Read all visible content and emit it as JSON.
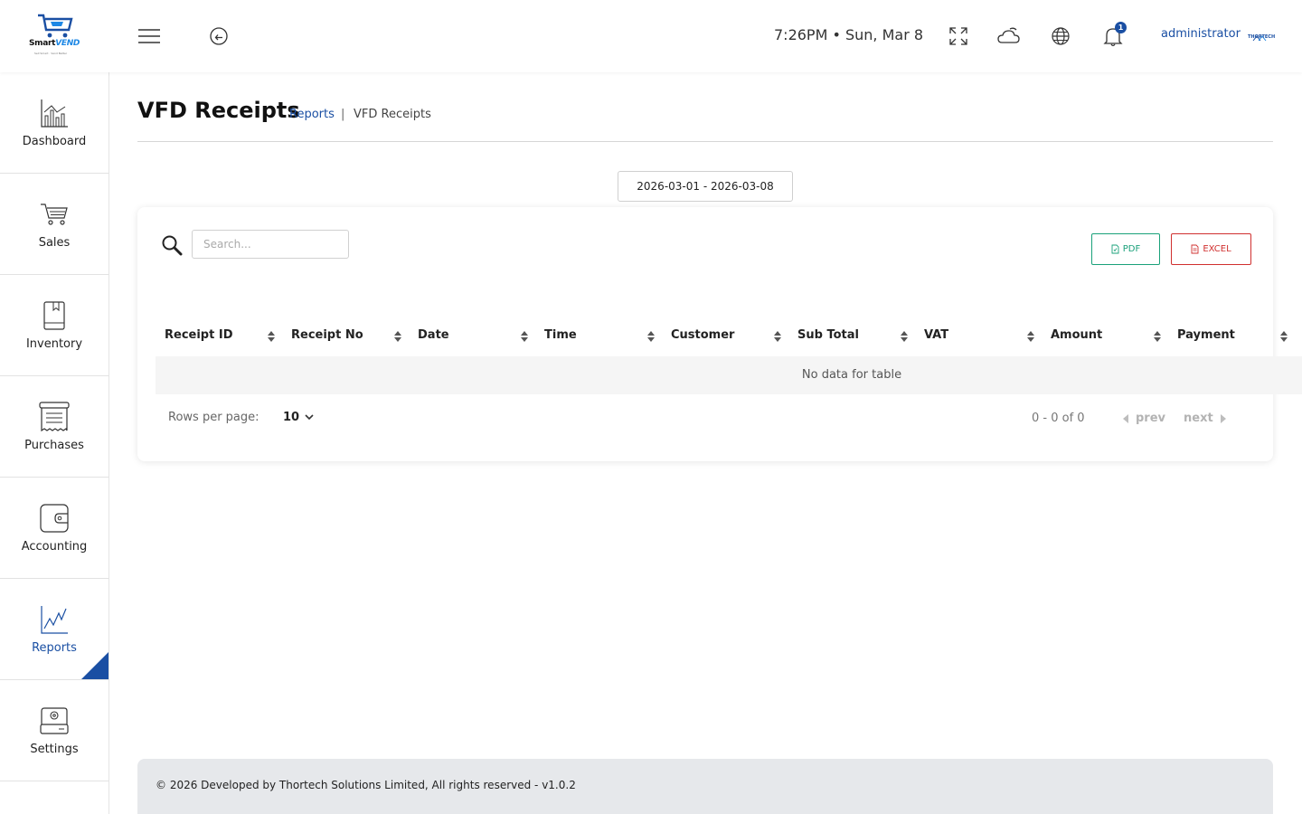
{
  "app": {
    "logo_text": "SmartVEND",
    "logo_part1": "Smart",
    "logo_part2": "VEND",
    "logo_tagline": "Sell Smart · Vend Better"
  },
  "header": {
    "clock": "7:26PM • Sun, Mar 8",
    "notification_count": "1",
    "username": "administrator",
    "company_logo_text": "THORTECH"
  },
  "sidebar": {
    "items": [
      {
        "label": "Dashboard",
        "icon": "chart-bar-icon",
        "active": false
      },
      {
        "label": "Sales",
        "icon": "shopping-cart-icon",
        "active": false
      },
      {
        "label": "Inventory",
        "icon": "book-icon",
        "active": false
      },
      {
        "label": "Purchases",
        "icon": "receipt-icon",
        "active": false
      },
      {
        "label": "Accounting",
        "icon": "wallet-icon",
        "active": false
      },
      {
        "label": "Reports",
        "icon": "line-chart-icon",
        "active": true
      },
      {
        "label": "Settings",
        "icon": "settings-drive-icon",
        "active": false
      }
    ]
  },
  "page": {
    "title": "VFD Receipts",
    "breadcrumb_link": "Reports",
    "breadcrumb_sep": "|",
    "breadcrumb_current": "VFD Receipts",
    "date_range": "2026-03-01 - 2026-03-08"
  },
  "toolbar": {
    "search_placeholder": "Search...",
    "pdf_label": "PDF",
    "excel_label": "EXCEL"
  },
  "table": {
    "columns": [
      "Receipt ID",
      "Receipt No",
      "Date",
      "Time",
      "Customer",
      "Sub Total",
      "VAT",
      "Amount",
      "Payment"
    ],
    "empty_message": "No data for table"
  },
  "pagination": {
    "rows_per_page_label": "Rows per page:",
    "rows_per_page_value": "10",
    "range": "0 - 0 of 0",
    "prev_label": "prev",
    "next_label": "next"
  },
  "footer": {
    "text": "© 2026 Developed by Thortech Solutions Limited, All rights reserved - v1.0.2"
  },
  "colors": {
    "brand_blue": "#1a4fa3",
    "pdf_green": "#1aa17a",
    "excel_red": "#d0302f",
    "footer_bg": "#e6e8eb"
  }
}
